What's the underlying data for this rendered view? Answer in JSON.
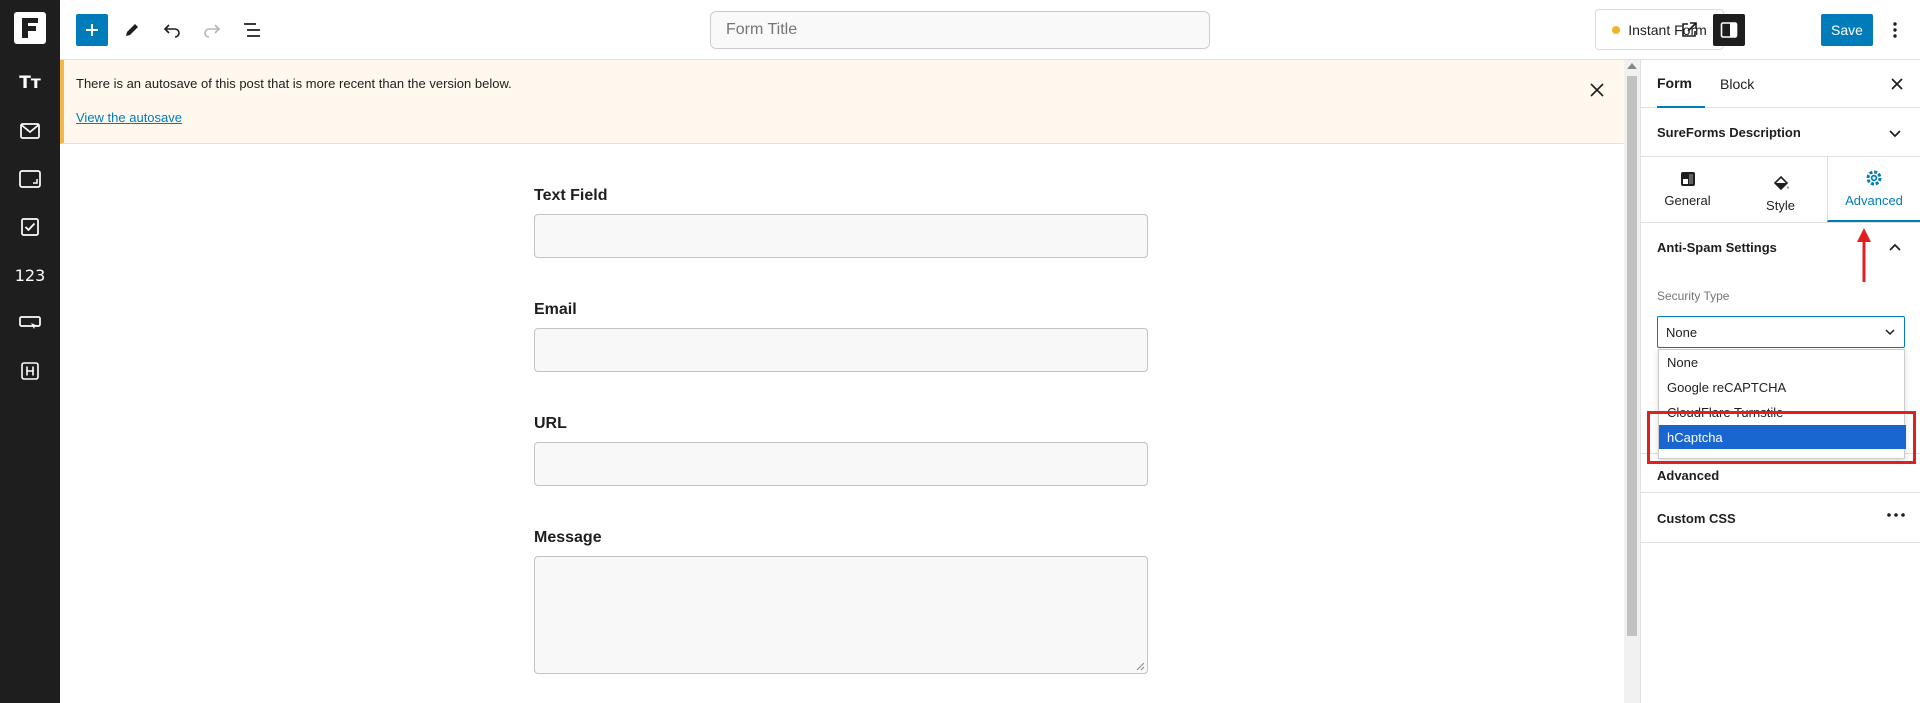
{
  "toolbar": {
    "title_placeholder": "Form Title",
    "instant_form_label": "Instant Form",
    "save_label": "Save"
  },
  "left_sidebar": {
    "items": [
      {
        "icon": "text-icon",
        "label": "Tт"
      },
      {
        "icon": "mail-icon"
      },
      {
        "icon": "phone-icon"
      },
      {
        "icon": "checkbox-icon"
      },
      {
        "icon": "number-icon",
        "label": "123"
      },
      {
        "icon": "button-icon"
      },
      {
        "icon": "hidden-field-icon"
      }
    ]
  },
  "notice": {
    "text": "There is an autosave of this post that is more recent than the version below.",
    "link": "View the autosave"
  },
  "form": {
    "fields": [
      {
        "label": "Text Field"
      },
      {
        "label": "Email"
      },
      {
        "label": "URL"
      },
      {
        "label": "Message"
      }
    ]
  },
  "sidebar": {
    "tabs": [
      "Form",
      "Block"
    ],
    "active_tab": "Form",
    "description_label": "SureForms Description",
    "segments": [
      {
        "label": "General",
        "icon": "layout-icon"
      },
      {
        "label": "Style",
        "icon": "paint-bucket-icon"
      },
      {
        "label": "Advanced",
        "icon": "gear-icon"
      }
    ],
    "active_segment": "Advanced",
    "anti_spam_label": "Anti-Spam Settings",
    "security_type_label": "Security Type",
    "security_value": "None",
    "options": [
      "None",
      "Google reCAPTCHA",
      "CloudFlare Turnstile",
      "hCaptcha"
    ],
    "highlighted_option": "hCaptcha",
    "advanced_label": "Advanced",
    "custom_css_label": "Custom CSS"
  },
  "colors": {
    "accent": "#007cba",
    "notice_bg": "#fef8ee",
    "highlight": "#1a66d0",
    "annotation": "#e02020"
  }
}
